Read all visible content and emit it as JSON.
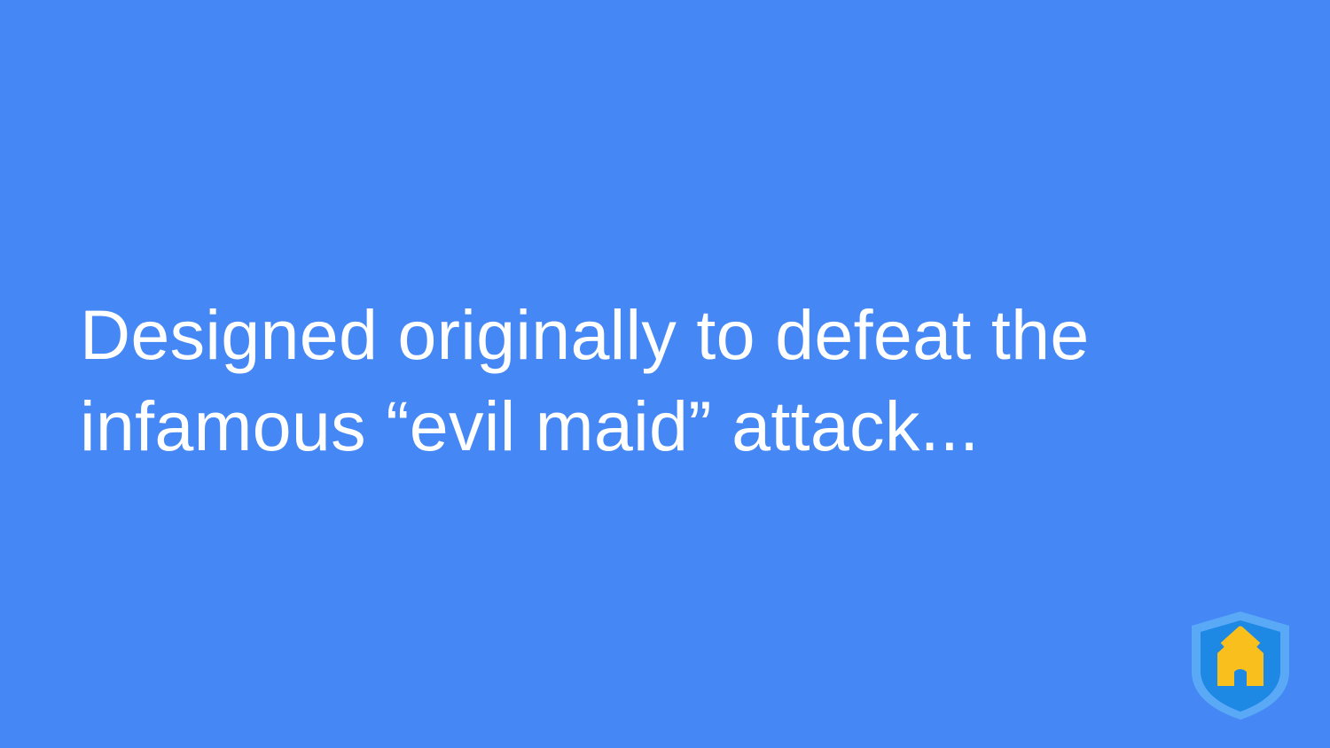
{
  "slide": {
    "text_lines": [
      "Designed originally to defeat the",
      "infamous “evil maid” attack..."
    ],
    "logo_icon": "shield-house-icon"
  },
  "colors": {
    "background": "#4587F5",
    "text": "#FFFFFF",
    "shield_outer": "#5AA9F7",
    "shield_inner": "#1E88E5",
    "house": "#F9BF1D"
  }
}
